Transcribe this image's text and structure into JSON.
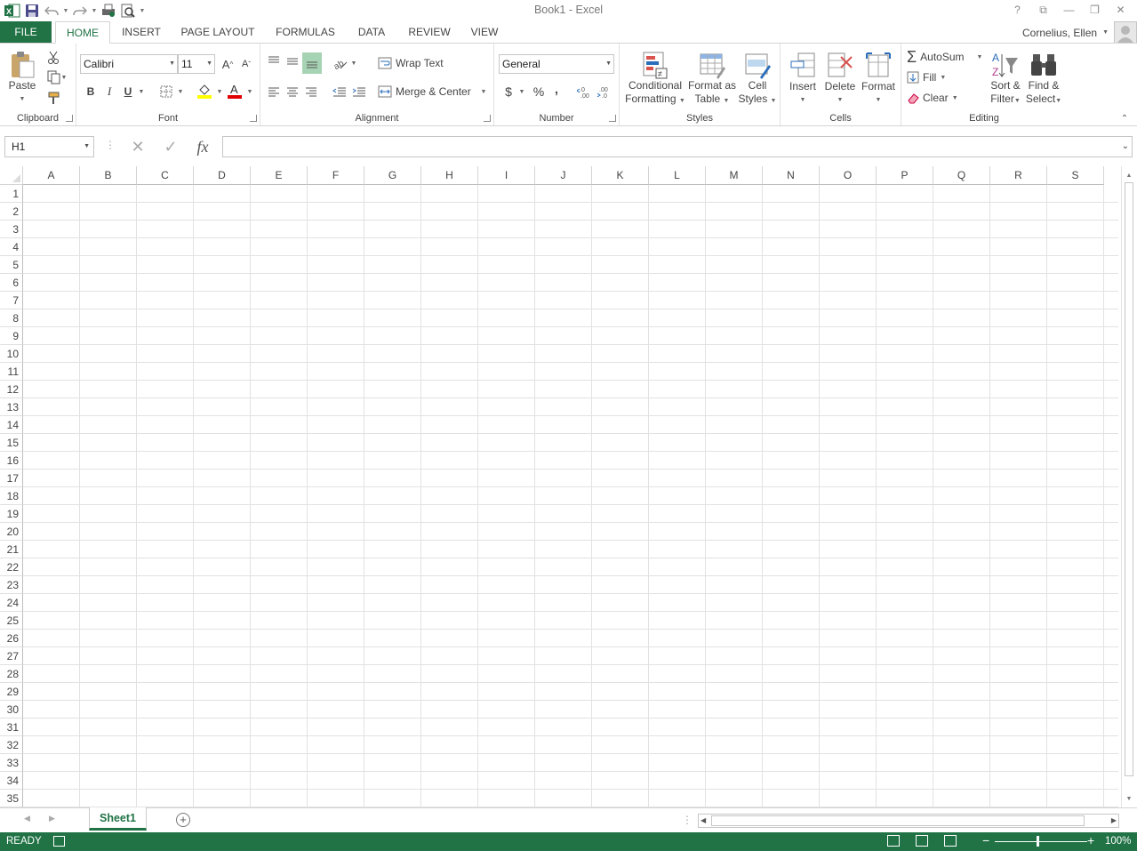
{
  "window": {
    "title": "Book1 - Excel"
  },
  "tabs": [
    "FILE",
    "HOME",
    "INSERT",
    "PAGE LAYOUT",
    "FORMULAS",
    "DATA",
    "REVIEW",
    "VIEW"
  ],
  "user": {
    "name": "Cornelius, Ellen"
  },
  "ribbon": {
    "clipboard": {
      "label": "Clipboard",
      "paste": "Paste"
    },
    "font": {
      "label": "Font",
      "family": "Calibri",
      "size": "11",
      "bold": "B",
      "italic": "I",
      "underline": "U"
    },
    "alignment": {
      "label": "Alignment",
      "wrap_text": "Wrap Text",
      "merge_center": "Merge & Center"
    },
    "number": {
      "label": "Number",
      "format": "General",
      "currency": "$",
      "percent": "%",
      "comma": ","
    },
    "styles": {
      "label": "Styles",
      "conditional_1": "Conditional",
      "conditional_2": "Formatting",
      "format_table_1": "Format as",
      "format_table_2": "Table",
      "cell_styles_1": "Cell",
      "cell_styles_2": "Styles"
    },
    "cells": {
      "label": "Cells",
      "insert": "Insert",
      "delete": "Delete",
      "format": "Format"
    },
    "editing": {
      "label": "Editing",
      "autosum": "AutoSum",
      "fill": "Fill",
      "clear": "Clear",
      "sort_1": "Sort &",
      "sort_2": "Filter",
      "find_1": "Find &",
      "find_2": "Select"
    }
  },
  "formula_bar": {
    "name_box": "H1",
    "fx": "fx",
    "value": ""
  },
  "grid": {
    "columns": [
      "A",
      "B",
      "C",
      "D",
      "E",
      "F",
      "G",
      "H",
      "I",
      "J",
      "K",
      "L",
      "M",
      "N",
      "O",
      "P",
      "Q",
      "R",
      "S"
    ],
    "rows": [
      "1",
      "2",
      "3",
      "4",
      "5",
      "6",
      "7",
      "8",
      "9",
      "10",
      "11",
      "12",
      "13",
      "14",
      "15",
      "16",
      "17",
      "18",
      "19",
      "20",
      "21",
      "22",
      "23",
      "24",
      "25",
      "26",
      "27",
      "28",
      "29",
      "30",
      "31",
      "32",
      "33",
      "34",
      "35"
    ]
  },
  "sheets": [
    "Sheet1"
  ],
  "status": {
    "ready": "READY",
    "zoom": "100%"
  },
  "colors": {
    "accent": "#217346"
  }
}
